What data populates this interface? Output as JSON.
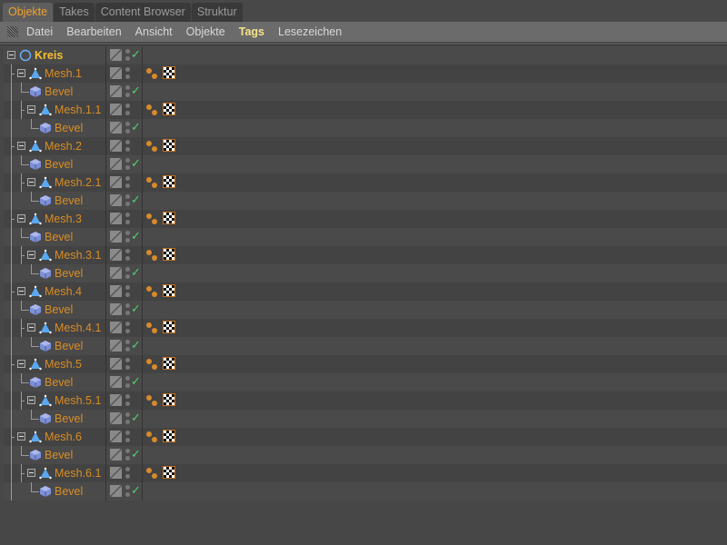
{
  "tabs": [
    {
      "label": "Objekte",
      "active": true
    },
    {
      "label": "Takes"
    },
    {
      "label": "Content Browser"
    },
    {
      "label": "Struktur"
    }
  ],
  "menu": [
    {
      "label": "Datei"
    },
    {
      "label": "Bearbeiten"
    },
    {
      "label": "Ansicht"
    },
    {
      "label": "Objekte"
    },
    {
      "label": "Tags",
      "highlight": true
    },
    {
      "label": "Lesezeichen"
    }
  ],
  "colors": {
    "object_name": "#d98d25",
    "root_name": "#f5c030",
    "check": "#4fd36a",
    "tab_active": "#f0a030"
  },
  "objects": [
    {
      "name": "Kreis",
      "depth": 0,
      "type": "circle-spline",
      "expanded": true,
      "enabled": true,
      "tags": false
    },
    {
      "name": "Mesh.1",
      "depth": 1,
      "type": "polygon-object",
      "expanded": true,
      "enabled": false,
      "tags": true
    },
    {
      "name": "Bevel",
      "depth": 2,
      "type": "bevel-deformer",
      "enabled": true,
      "tags": false
    },
    {
      "name": "Mesh.1.1",
      "depth": 2,
      "type": "polygon-object",
      "expanded": true,
      "enabled": false,
      "tags": true
    },
    {
      "name": "Bevel",
      "depth": 3,
      "type": "bevel-deformer",
      "enabled": true,
      "tags": false
    },
    {
      "name": "Mesh.2",
      "depth": 1,
      "type": "polygon-object",
      "expanded": true,
      "enabled": false,
      "tags": true
    },
    {
      "name": "Bevel",
      "depth": 2,
      "type": "bevel-deformer",
      "enabled": true,
      "tags": false
    },
    {
      "name": "Mesh.2.1",
      "depth": 2,
      "type": "polygon-object",
      "expanded": true,
      "enabled": false,
      "tags": true
    },
    {
      "name": "Bevel",
      "depth": 3,
      "type": "bevel-deformer",
      "enabled": true,
      "tags": false
    },
    {
      "name": "Mesh.3",
      "depth": 1,
      "type": "polygon-object",
      "expanded": true,
      "enabled": false,
      "tags": true
    },
    {
      "name": "Bevel",
      "depth": 2,
      "type": "bevel-deformer",
      "enabled": true,
      "tags": false
    },
    {
      "name": "Mesh.3.1",
      "depth": 2,
      "type": "polygon-object",
      "expanded": true,
      "enabled": false,
      "tags": true
    },
    {
      "name": "Bevel",
      "depth": 3,
      "type": "bevel-deformer",
      "enabled": true,
      "tags": false
    },
    {
      "name": "Mesh.4",
      "depth": 1,
      "type": "polygon-object",
      "expanded": true,
      "enabled": false,
      "tags": true
    },
    {
      "name": "Bevel",
      "depth": 2,
      "type": "bevel-deformer",
      "enabled": true,
      "tags": false
    },
    {
      "name": "Mesh.4.1",
      "depth": 2,
      "type": "polygon-object",
      "expanded": true,
      "enabled": false,
      "tags": true
    },
    {
      "name": "Bevel",
      "depth": 3,
      "type": "bevel-deformer",
      "enabled": true,
      "tags": false
    },
    {
      "name": "Mesh.5",
      "depth": 1,
      "type": "polygon-object",
      "expanded": true,
      "enabled": false,
      "tags": true
    },
    {
      "name": "Bevel",
      "depth": 2,
      "type": "bevel-deformer",
      "enabled": true,
      "tags": false
    },
    {
      "name": "Mesh.5.1",
      "depth": 2,
      "type": "polygon-object",
      "expanded": true,
      "enabled": false,
      "tags": true
    },
    {
      "name": "Bevel",
      "depth": 3,
      "type": "bevel-deformer",
      "enabled": true,
      "tags": false
    },
    {
      "name": "Mesh.6",
      "depth": 1,
      "type": "polygon-object",
      "expanded": true,
      "enabled": false,
      "tags": true
    },
    {
      "name": "Bevel",
      "depth": 2,
      "type": "bevel-deformer",
      "enabled": true,
      "tags": false
    },
    {
      "name": "Mesh.6.1",
      "depth": 2,
      "type": "polygon-object",
      "expanded": true,
      "enabled": false,
      "tags": true
    },
    {
      "name": "Bevel",
      "depth": 3,
      "type": "bevel-deformer",
      "enabled": true,
      "tags": false
    }
  ],
  "tag_icons": [
    "phong-tag-icon",
    "material-tag-icon"
  ],
  "check_glyph": "✓"
}
